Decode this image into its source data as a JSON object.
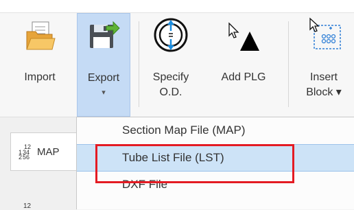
{
  "ribbon": {
    "buttons": [
      {
        "label": "Import"
      },
      {
        "label": "Export",
        "caret": "▾"
      },
      {
        "label": "Specify\nO.D."
      },
      {
        "label": "Add PLG"
      },
      {
        "label": "Insert\nBlock ▾"
      }
    ]
  },
  "left_pane": {
    "tab_label": "MAP"
  },
  "export_menu": {
    "items": [
      {
        "label": "Section Map File (MAP)"
      },
      {
        "label": "Tube List File (LST)"
      },
      {
        "label": "DXF File"
      }
    ]
  },
  "colors": {
    "highlight": "#cde3f7",
    "selected_button": "#c5dbf5",
    "annotation_red": "#e41b23"
  }
}
